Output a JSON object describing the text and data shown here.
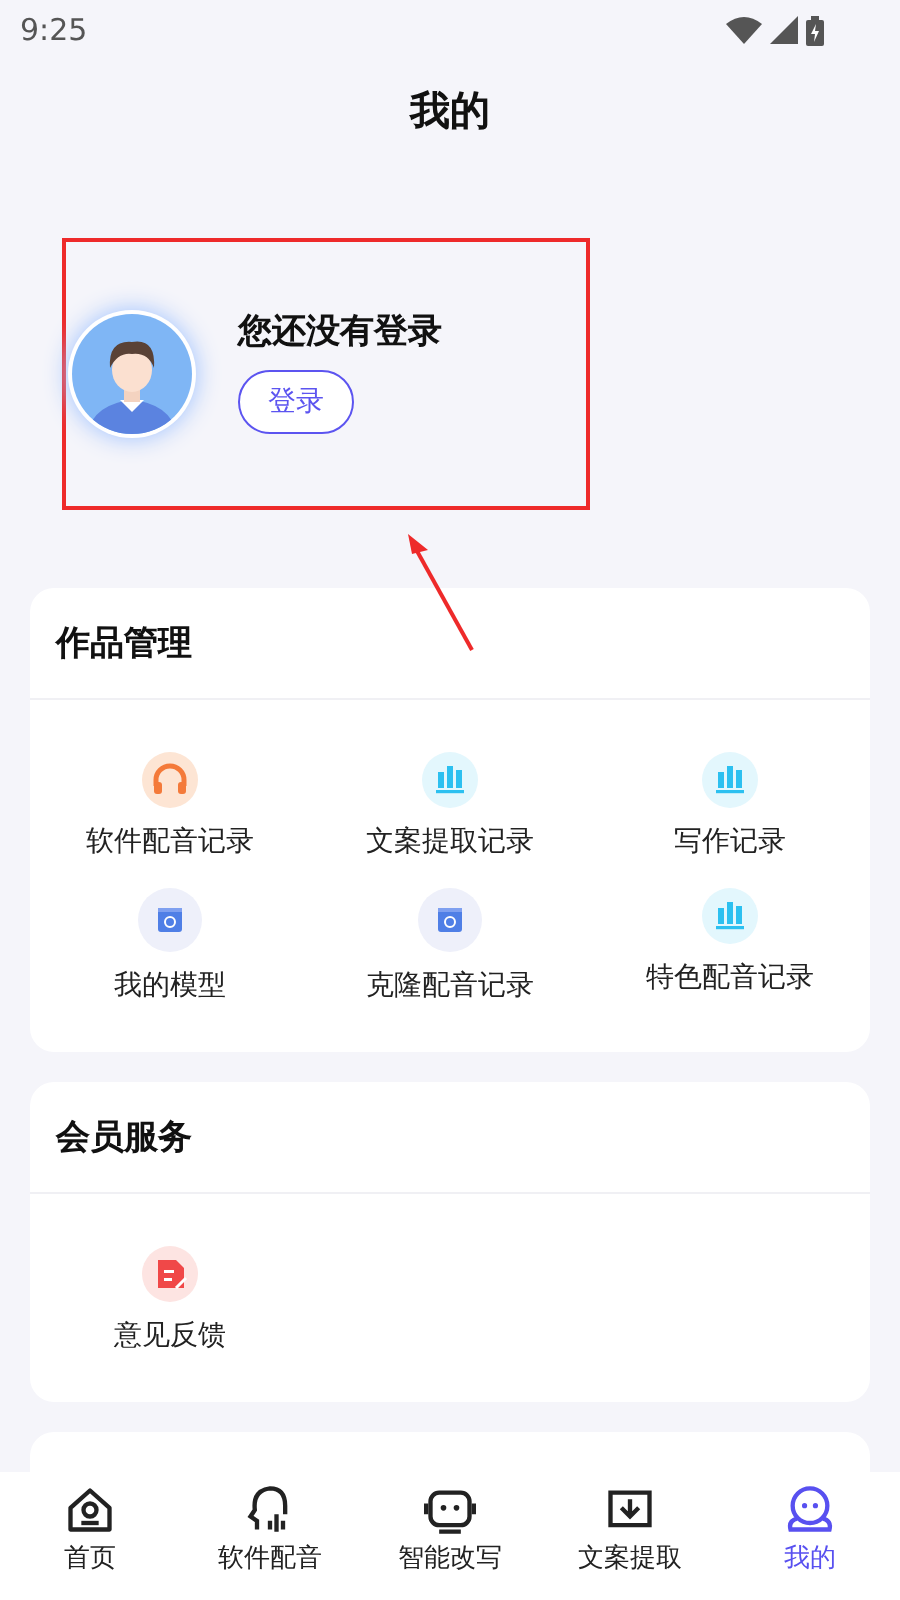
{
  "status_bar": {
    "time": "9:25"
  },
  "title": "我的",
  "profile": {
    "message": "您还没有登录",
    "login_button": "登录"
  },
  "sections": [
    {
      "title": "作品管理",
      "items": [
        {
          "label": "软件配音记录",
          "kind": "headphones"
        },
        {
          "label": "文案提取记录",
          "kind": "bars"
        },
        {
          "label": "写作记录",
          "kind": "bars"
        },
        {
          "label": "我的模型",
          "kind": "album"
        },
        {
          "label": "克隆配音记录",
          "kind": "album"
        },
        {
          "label": "特色配音记录",
          "kind": "bars"
        }
      ]
    },
    {
      "title": "会员服务",
      "items": [
        {
          "label": "意见反馈",
          "kind": "note"
        }
      ]
    }
  ],
  "tabs": [
    {
      "label": "首页",
      "kind": "home",
      "selected": false
    },
    {
      "label": "软件配音",
      "kind": "voice",
      "selected": false
    },
    {
      "label": "智能改写",
      "kind": "robot",
      "selected": false
    },
    {
      "label": "文案提取",
      "kind": "download",
      "selected": false
    },
    {
      "label": "我的",
      "kind": "person",
      "selected": true
    }
  ]
}
